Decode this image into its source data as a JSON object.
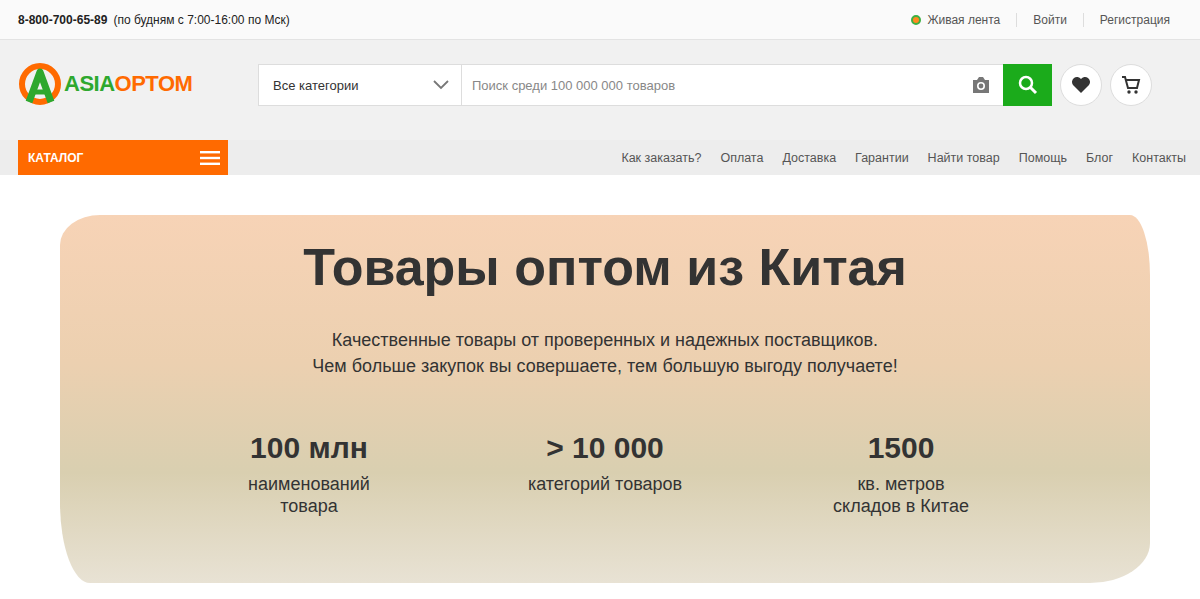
{
  "top_bar": {
    "phone": "8-800-700-65-89",
    "hours": "(по будням с 7:00-16:00 по Мск)",
    "live_feed": "Живая лента",
    "links": [
      "Войти",
      "Регистрация"
    ]
  },
  "logo": {
    "part1": "ASIA",
    "part2": "OPTOM"
  },
  "search": {
    "category": "Все категории",
    "placeholder": "Поиск среди 100 000 000 товаров"
  },
  "catalog": {
    "label": "КАТАЛОГ"
  },
  "nav": [
    "Как заказать?",
    "Оплата",
    "Доставка",
    "Гарантии",
    "Найти товар",
    "Помощь",
    "Блог",
    "Контакты"
  ],
  "hero": {
    "title": "Товары оптом из Китая",
    "subtitle": [
      "Качественные товары от проверенных и надежных поставщиков.",
      "Чем больше закупок вы совершаете, тем большую выгоду получаете!"
    ],
    "stats": [
      {
        "value": "100 млн",
        "label_lines": [
          "наименований",
          "товара"
        ]
      },
      {
        "value": "> 10 000",
        "label_lines": [
          "категорий товаров"
        ]
      },
      {
        "value": "1500",
        "label_lines": [
          "кв. метров",
          "складов в Китае"
        ]
      }
    ]
  }
}
